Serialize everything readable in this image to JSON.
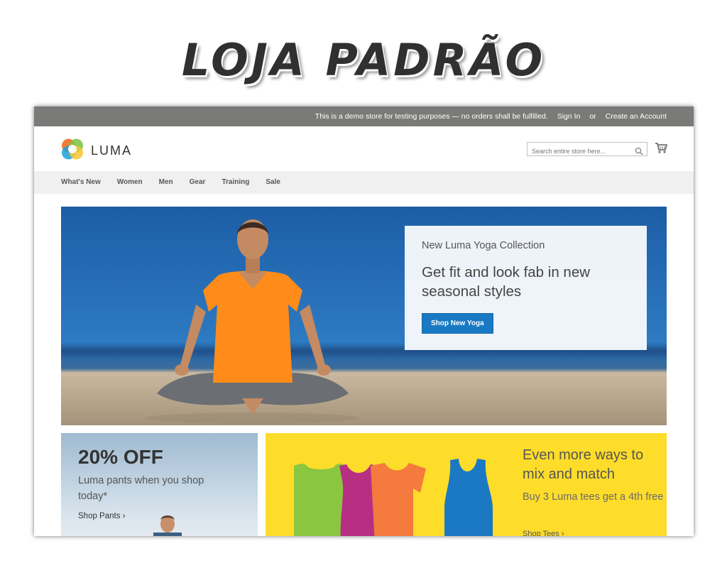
{
  "page_title": "LOJA PADRÃO",
  "store": {
    "notice": "This is a demo store for testing purposes — no orders shall be fulfilled.",
    "sign_in": "Sign In",
    "or": "or",
    "create_account": "Create an Account",
    "logo_text": "LUMA",
    "search_placeholder": "Search entire store here...",
    "nav": [
      "What's New",
      "Women",
      "Men",
      "Gear",
      "Training",
      "Sale"
    ],
    "hero": {
      "subtitle": "New Luma Yoga Collection",
      "headline": "Get fit and look fab in new seasonal styles",
      "button": "Shop New Yoga"
    },
    "promo_left": {
      "headline": "20% OFF",
      "text": "Luma pants when you shop today*",
      "link": "Shop Pants ›"
    },
    "promo_right": {
      "headline": "Even more ways to mix and match",
      "text": "Buy 3 Luma tees get a 4th free",
      "link": "Shop Tees ›"
    },
    "colors": {
      "topbar": "#7a7a78",
      "accent": "#1979c3",
      "nav_bg": "#f0f0f0",
      "promo_yellow": "#fddc2a"
    },
    "icons": [
      "luma-logo-icon",
      "search-icon",
      "cart-icon",
      "chevron-right-icon"
    ]
  }
}
